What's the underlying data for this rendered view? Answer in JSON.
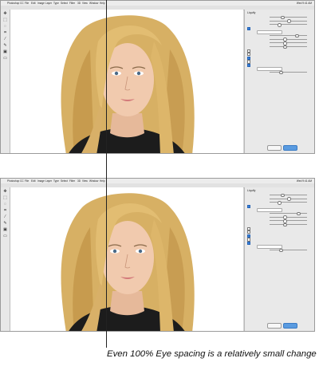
{
  "app": {
    "menu": [
      "Photoshop CC",
      "File",
      "Edit",
      "Image",
      "Layer",
      "Type",
      "Select",
      "Filter",
      "3D",
      "View",
      "Window",
      "Help"
    ],
    "status_right": "Wed 9:41 AM",
    "document_title": "",
    "tools": [
      "move-tool-icon",
      "marquee-tool-icon",
      "lasso-tool-icon",
      "crop-tool-icon",
      "eyedropper-tool-icon",
      "brush-tool-icon",
      "stamp-tool-icon",
      "eraser-tool-icon"
    ]
  },
  "panel": {
    "title": "Liquify",
    "ok_label": "",
    "cancel_label": ""
  },
  "caption": "Even 100% Eye spacing is a relatively small change",
  "colors": {
    "hair": "#d9b46a",
    "hair_dark": "#b8893f",
    "skin": "#f0c9ad",
    "shirt": "#1c1c1c",
    "traffic_red": "#ff5f57",
    "traffic_yellow": "#febc2e",
    "traffic_green": "#28c840"
  }
}
